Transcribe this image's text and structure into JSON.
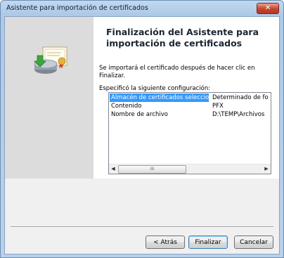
{
  "window": {
    "title": "Asistente para importación de certificados",
    "close_glyph": "✕"
  },
  "wizard": {
    "heading": "Finalización del Asistente para importación de certificados",
    "intro": "Se importará el certificado después de hacer clic en Finalizar.",
    "config_label": "Especificó la siguiente configuración:",
    "settings": [
      {
        "name": "Almacén de certificados seleccionado",
        "value": "Determinado de fo"
      },
      {
        "name": "Contenido",
        "value": "PFX"
      },
      {
        "name": "Nombre de archivo",
        "value": "D:\\TEMP\\Archivos"
      }
    ],
    "scroll_left": "◀",
    "scroll_right": "▶",
    "scroll_thumb_grip": "III"
  },
  "buttons": {
    "back": "< Atrás",
    "finish": "Finalizar",
    "cancel": "Cancelar"
  },
  "icons": {
    "sidebar": "certificate-icon"
  },
  "colors": {
    "selection": "#3399ff",
    "close": "#c6442c"
  }
}
